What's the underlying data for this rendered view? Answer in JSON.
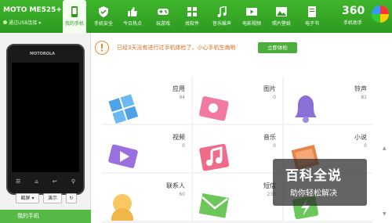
{
  "device": {
    "name": "MOTO ME525+",
    "connection": "通过USB连接"
  },
  "nav": [
    {
      "label": "我的手机",
      "icon": "phone-icon",
      "active": true
    },
    {
      "label": "手机安全",
      "icon": "shield-icon"
    },
    {
      "label": "今日热点",
      "icon": "thumbs-up-icon"
    },
    {
      "label": "玩游戏",
      "icon": "gamepad-icon"
    },
    {
      "label": "找软件",
      "icon": "grid-icon"
    },
    {
      "label": "音乐躲声",
      "icon": "music-note-icon"
    },
    {
      "label": "电影视频",
      "icon": "film-icon"
    },
    {
      "label": "照片壁纸",
      "icon": "image-icon"
    },
    {
      "label": "电子书",
      "icon": "book-icon"
    }
  ],
  "logo": {
    "text": "360",
    "sub": "手机助手"
  },
  "phone": {
    "brand": "MOTOROLA"
  },
  "left_buttons": {
    "screenshot": "截屏",
    "demo": "演示"
  },
  "my_phone_label": "我的手机",
  "alert": {
    "text": "已经3天没有进行过手机体检了，小心手机生病哟",
    "button": "立即体检"
  },
  "categories": [
    {
      "name": "应用",
      "count": "94",
      "icon": "apps-icon",
      "color": "#4ea2e8"
    },
    {
      "name": "图片",
      "count": "0",
      "icon": "pictures-icon",
      "color": "#f07aa0"
    },
    {
      "name": "铃声",
      "count": "81",
      "icon": "bell-icon",
      "color": "#8a6fd6"
    },
    {
      "name": "视频",
      "count": "0",
      "icon": "video-icon",
      "color": "#9a6fe0"
    },
    {
      "name": "音乐",
      "count": "0",
      "icon": "music-icon",
      "color": "#f06a8a"
    },
    {
      "name": "小说",
      "count": "0",
      "icon": "novel-icon",
      "color": "#e8834a"
    },
    {
      "name": "联系人",
      "count": "60",
      "icon": "contacts-icon",
      "color": "#f0b64a"
    },
    {
      "name": "短信",
      "count": "233",
      "icon": "sms-icon",
      "color": "#6cc65a"
    }
  ],
  "watermark": {
    "line1": "百科全说",
    "line2": "助你轻松解决"
  }
}
